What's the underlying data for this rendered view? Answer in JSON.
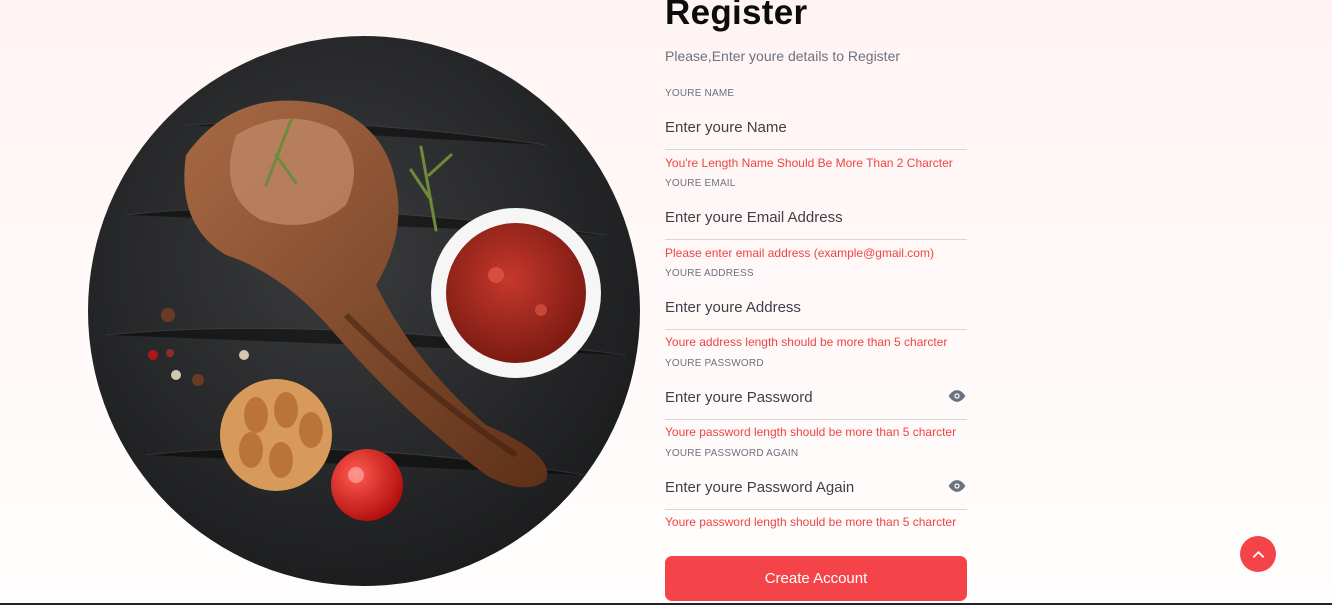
{
  "form": {
    "title": "Register",
    "subtitle": "Please,Enter youre details to Register",
    "fields": [
      {
        "label": "YOURE NAME",
        "placeholder": "Enter youre Name",
        "value": "",
        "error": "You're Length Name Should Be More Than 2 Charcter"
      },
      {
        "label": "YOURE EMAIL",
        "placeholder": "Enter youre Email Address",
        "value": "",
        "error": "Please enter email address (example@gmail.com)"
      },
      {
        "label": "YOURE ADDRESS",
        "placeholder": "Enter youre Address",
        "value": "",
        "error": "Youre address length should be more than 5 charcter"
      },
      {
        "label": "YOURE PASSWORD",
        "placeholder": "Enter youre Password",
        "value": "",
        "error": "Youre password length should be more than 5 charcter",
        "icon": "eye-icon"
      },
      {
        "label": "YOURE PASSWORD AGAIN",
        "placeholder": "Enter youre Password Again",
        "value": "",
        "error": "Youre password length should be more than 5 charcter",
        "icon": "eye-icon"
      }
    ],
    "submit_label": "Create Account"
  },
  "scroll_top": {
    "icon": "chevron-up-icon"
  },
  "hero": {
    "image": "steak-on-slate-plate"
  },
  "colors": {
    "accent": "#f4444a",
    "error": "#ef4444",
    "muted": "#6b7280",
    "background": "#fff4f3"
  }
}
